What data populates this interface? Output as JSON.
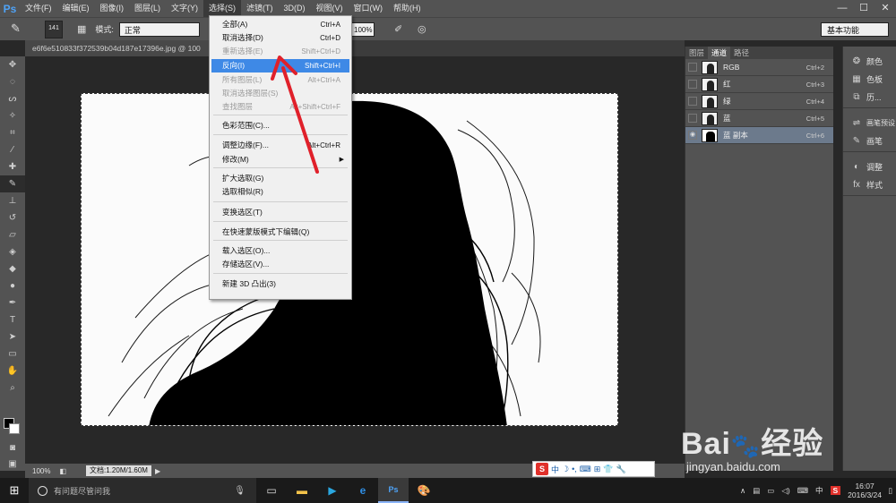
{
  "app": {
    "logo": "Ps",
    "menu": [
      "文件(F)",
      "编辑(E)",
      "图像(I)",
      "图层(L)",
      "文字(Y)",
      "选择(S)",
      "滤镜(T)",
      "3D(D)",
      "视图(V)",
      "窗口(W)",
      "帮助(H)"
    ],
    "active_menu_index": 5,
    "window_controls": [
      "—",
      "☐",
      "✕"
    ]
  },
  "options_bar": {
    "brush_size": "141",
    "mode_label": "模式:",
    "mode_value": "正常",
    "zoom_value": "100%",
    "workspace": "基本功能"
  },
  "document": {
    "tab_title": "e6f6e510833f372539b04d187e17396e.jpg @ 100",
    "zoom": "100%",
    "doc_info": "文档:1.20M/1.60M"
  },
  "select_menu": {
    "items": [
      {
        "label": "全部(A)",
        "shortcut": "Ctrl+A",
        "state": "normal"
      },
      {
        "label": "取消选择(D)",
        "shortcut": "Ctrl+D",
        "state": "normal"
      },
      {
        "label": "重新选择(E)",
        "shortcut": "Shift+Ctrl+D",
        "state": "disabled"
      },
      {
        "label": "反向(I)",
        "shortcut": "Shift+Ctrl+I",
        "state": "highlight"
      },
      {
        "label": "所有图层(L)",
        "shortcut": "Alt+Ctrl+A",
        "state": "disabled"
      },
      {
        "label": "取消选择图层(S)",
        "shortcut": "",
        "state": "disabled"
      },
      {
        "label": "查找图层",
        "shortcut": "Alt+Shift+Ctrl+F",
        "state": "disabled"
      },
      {
        "label": "色彩范围(C)...",
        "shortcut": "",
        "state": "normal"
      },
      {
        "label": "调整边缘(F)...",
        "shortcut": "Alt+Ctrl+R",
        "state": "normal"
      },
      {
        "label": "修改(M)",
        "shortcut": "",
        "state": "normal",
        "submenu": true
      },
      {
        "label": "扩大选取(G)",
        "shortcut": "",
        "state": "normal"
      },
      {
        "label": "选取相似(R)",
        "shortcut": "",
        "state": "normal"
      },
      {
        "label": "变换选区(T)",
        "shortcut": "",
        "state": "normal"
      },
      {
        "label": "在快速蒙版模式下编辑(Q)",
        "shortcut": "",
        "state": "normal"
      },
      {
        "label": "载入选区(O)...",
        "shortcut": "",
        "state": "normal"
      },
      {
        "label": "存储选区(V)...",
        "shortcut": "",
        "state": "normal"
      },
      {
        "label": "新建 3D 凸出(3)",
        "shortcut": "",
        "state": "normal"
      }
    ]
  },
  "channels_panel": {
    "tabs": [
      "图层",
      "通道",
      "路径"
    ],
    "active_tab_index": 1,
    "channels": [
      {
        "name": "RGB",
        "shortcut": "Ctrl+2",
        "visible": false,
        "selected": false
      },
      {
        "name": "红",
        "shortcut": "Ctrl+3",
        "visible": false,
        "selected": false
      },
      {
        "name": "绿",
        "shortcut": "Ctrl+4",
        "visible": false,
        "selected": false
      },
      {
        "name": "蓝",
        "shortcut": "Ctrl+5",
        "visible": false,
        "selected": false
      },
      {
        "name": "蓝 副本",
        "shortcut": "Ctrl+6",
        "visible": true,
        "selected": true
      }
    ]
  },
  "side_panel": {
    "groups": [
      [
        {
          "icon": "palette-icon",
          "label": "颜色"
        },
        {
          "icon": "swatches-icon",
          "label": "色板"
        },
        {
          "icon": "history-icon",
          "label": "历..."
        }
      ],
      [
        {
          "icon": "brush-preset-icon",
          "label": "画笔预设"
        },
        {
          "icon": "brush-icon",
          "label": "画笔"
        }
      ],
      [
        {
          "icon": "adjustments-icon",
          "label": "调整"
        },
        {
          "icon": "styles-icon",
          "label": "样式"
        }
      ]
    ]
  },
  "ime": {
    "items": [
      "中",
      "☽",
      "•,",
      "⌨",
      "⊞",
      "👕",
      "🔧"
    ]
  },
  "taskbar": {
    "search_placeholder": "有问题尽管问我",
    "tray_lang": "中",
    "time": "16:07",
    "date": "2016/3/24"
  },
  "watermark": {
    "brand": "Bai",
    "brand_suffix": "经验",
    "url": "jingyan.baidu.com"
  },
  "colors": {
    "menu_highlight": "#3e89e6",
    "ps_blue": "#4fa3f7",
    "arrow_red": "#e0202a"
  }
}
